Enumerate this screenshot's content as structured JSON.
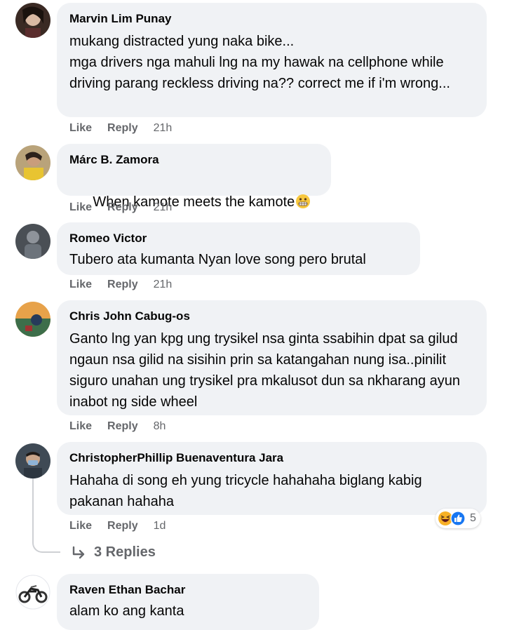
{
  "comments": [
    {
      "author": "Marvin Lim Punay",
      "text": "mukang distracted yung naka bike...\nmga drivers nga mahuli lng na my hawak na cellphone while driving parang reckless driving na?? correct me if i'm wrong...",
      "like": "Like",
      "reply": "Reply",
      "time": "21h"
    },
    {
      "author": "Márc B. Zamora",
      "text": "When kamote meets the kamote",
      "emoji": "grimacing-face",
      "like": "Like",
      "reply": "Reply",
      "time": "21h"
    },
    {
      "author": "Romeo Victor",
      "text": "Tubero ata kumanta Nyan love song pero brutal",
      "like": "Like",
      "reply": "Reply",
      "time": "21h"
    },
    {
      "author": "Chris John Cabug-os",
      "text": "Ganto lng yan kpg ung trysikel nsa ginta ssabihin dpat sa gilud ngaun nsa gilid na sisihin prin sa katangahan nung isa..pinilit siguro unahan ung trysikel pra mkalusot dun sa nkharang ayun inabot ng side wheel",
      "like": "Like",
      "reply": "Reply",
      "time": "8h"
    },
    {
      "author": "ChristopherPhillip Buenaventura Jara",
      "text": "Hahaha di song eh yung tricycle hahahaha biglang kabig pakanan hahaha",
      "like": "Like",
      "reply": "Reply",
      "time": "1d",
      "reactions": {
        "icons": [
          "haha-reaction-icon",
          "like-reaction-icon"
        ],
        "count": "5"
      },
      "replies_label": "3 Replies"
    },
    {
      "author": "Raven Ethan Bachar",
      "text": "alam ko ang kanta"
    }
  ],
  "colors": {
    "bubble": "#f0f2f5",
    "name": "#050505",
    "meta": "#65676b",
    "like_blue": "#1877f2",
    "haha_yellow": "#f7b125"
  }
}
